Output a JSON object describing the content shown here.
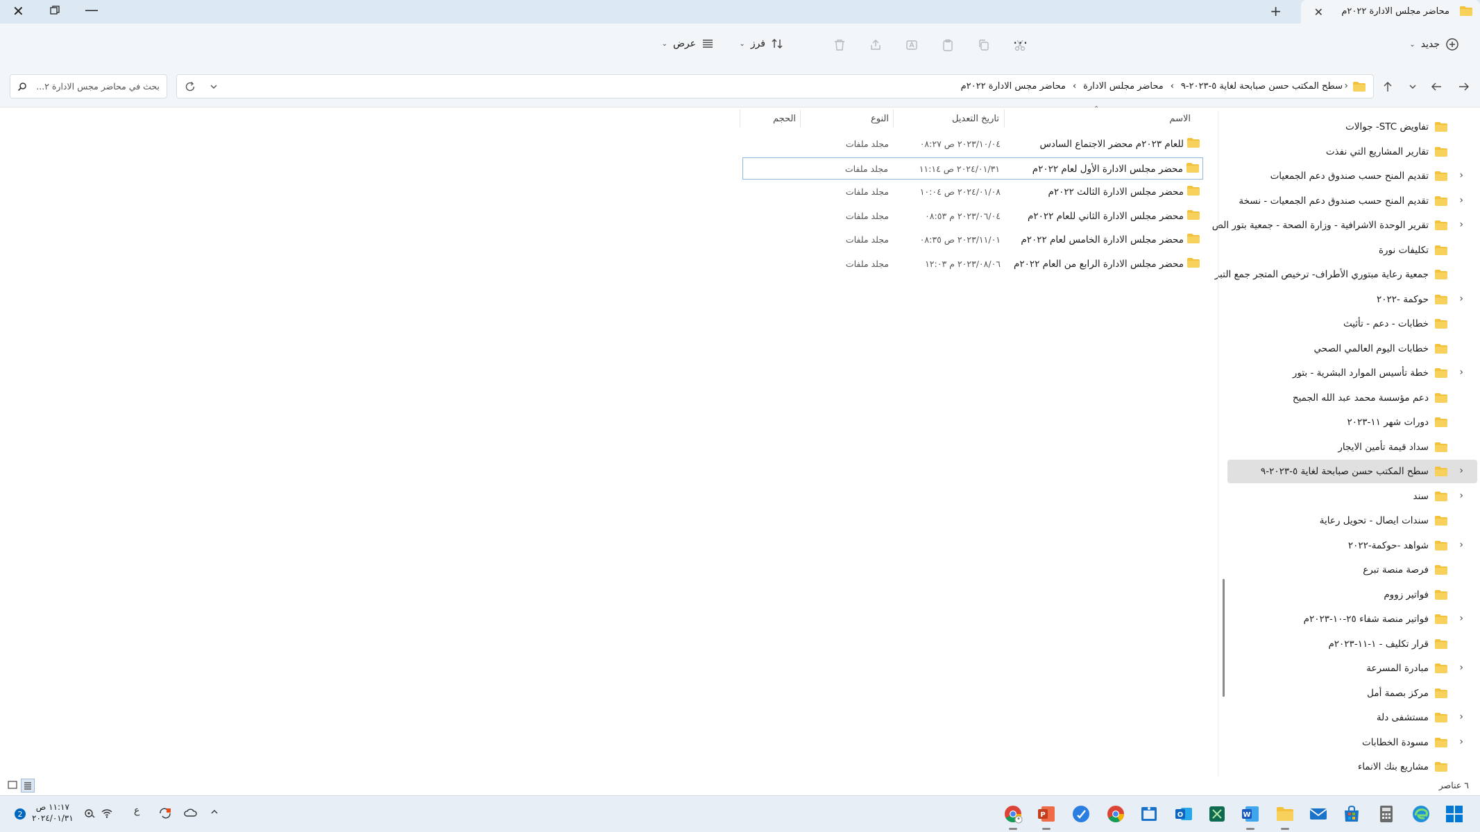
{
  "window": {
    "tab_title": "محاضر مجلس الادارة ٢٠٢٢م",
    "tab_close": "✕",
    "new_tab": "+",
    "close": "✕",
    "minimize": "—"
  },
  "toolbar": {
    "new_label": "جديد",
    "sort_label": "فرز",
    "view_label": "عرض",
    "more": "···"
  },
  "address": {
    "crumbs": [
      "سطح المكتب حسن صبابحة لغاية ٥-٢٠٢٣-٩",
      "›",
      "محاضر مجلس الادارة",
      "›",
      "محاضر مجس الادارة ٢٠٢٢م"
    ],
    "search_placeholder": "بحث في محاضر مجس الادارة ٢..."
  },
  "nav": {
    "items": [
      {
        "label": "تفاويض STC- جوالات",
        "chevron": false
      },
      {
        "label": "تقارير المشاريع التي نفذت",
        "chevron": false
      },
      {
        "label": "تقديم المنح حسب صندوق دعم الجمعيات",
        "chevron": true
      },
      {
        "label": "تقديم المنح حسب صندوق دعم الجمعيات - نسخة",
        "chevron": true
      },
      {
        "label": "تقرير الوحدة الاشرافية - وزارة الصحة - جمعية بتور الص",
        "chevron": true
      },
      {
        "label": "تكليفات نورة",
        "chevron": false
      },
      {
        "label": "جمعية رعاية مبتوري الأطراف- ترخيص المتجر جمع التبر",
        "chevron": false
      },
      {
        "label": "حوكمة -٢٠٢٢",
        "chevron": true
      },
      {
        "label": "خطابات - دعم - تأثيث",
        "chevron": false
      },
      {
        "label": "خطابات اليوم العالمي الصحي",
        "chevron": false
      },
      {
        "label": "خطة تأسيس الموارد البشرية - بتور",
        "chevron": true
      },
      {
        "label": "دعم مؤسسة محمد عبد الله الجميح",
        "chevron": false
      },
      {
        "label": "دورات شهر ١١-٢٠٢٣",
        "chevron": false
      },
      {
        "label": "سداد قيمة تأمين الايجار",
        "chevron": false
      },
      {
        "label": "سطح المكتب حسن صبابحة لغاية ٥-٢٠٢٣-٩",
        "chevron": true,
        "selected": true
      },
      {
        "label": "سند",
        "chevron": true
      },
      {
        "label": "سندات ايصال - تحويل رعاية",
        "chevron": false
      },
      {
        "label": "شواهد -حوكمة-٢٠٢٢",
        "chevron": true
      },
      {
        "label": "فرصة منصة تبرع",
        "chevron": false
      },
      {
        "label": "فواتير زووم",
        "chevron": false
      },
      {
        "label": "فواتير منصة شفاء ٢٥-١٠-٢٠٢٣م",
        "chevron": true
      },
      {
        "label": "قرار تكليف - ١-١١-٢٠٢٣م",
        "chevron": false
      },
      {
        "label": "مبادرة المسرعة",
        "chevron": true
      },
      {
        "label": "مركز بصمة أمل",
        "chevron": false
      },
      {
        "label": "مستشفى دلة",
        "chevron": true
      },
      {
        "label": "مسودة الخطابات",
        "chevron": true
      },
      {
        "label": "مشاريع بنك الانماء",
        "chevron": false
      }
    ]
  },
  "list": {
    "columns": {
      "name": "الاسم",
      "modified": "تاريخ التعديل",
      "type": "النوع",
      "size": "الحجم"
    },
    "rows": [
      {
        "name": "للعام ٢٠٢٣م محضر الاجتماع السادس",
        "date": "٢٠٢٣/١٠/٠٤ ص ٠٨:٢٧",
        "type": "مجلد ملفات"
      },
      {
        "name": "محضر مجلس الادارة الأول لعام ٢٠٢٢م",
        "date": "٢٠٢٤/٠١/٣١ ص ١١:١٤",
        "type": "مجلد ملفات",
        "selected": true
      },
      {
        "name": "محضر مجلس الادارة الثالث ٢٠٢٢م",
        "date": "٢٠٢٤/٠١/٠٨ ص ١٠:٠٤",
        "type": "مجلد ملفات"
      },
      {
        "name": "محضر مجلس الادارة الثاني للعام ٢٠٢٢م",
        "date": "٢٠٢٣/٠٦/٠٤ م ٠٨:٥٣",
        "type": "مجلد ملفات"
      },
      {
        "name": "محضر مجلس الادارة الخامس لعام ٢٠٢٢م",
        "date": "٢٠٢٣/١١/٠١ ص ٠٨:٣٥",
        "type": "مجلد ملفات"
      },
      {
        "name": "محضر مجلس الادارة الرابع من العام ٢٠٢٢م",
        "date": "٢٠٢٣/٠٨/٠٦ م ١٢:٠٣",
        "type": "مجلد ملفات"
      }
    ]
  },
  "status": {
    "item_count": "٦ عناصر"
  },
  "taskbar": {
    "time": "١١:١٧ ص",
    "date": "٢٠٢٤/٠١/٣١",
    "lang": "ع"
  },
  "colors": {
    "folder": "#f3c13a",
    "accent": "#0067c0",
    "selection": "#e0e0e0"
  }
}
